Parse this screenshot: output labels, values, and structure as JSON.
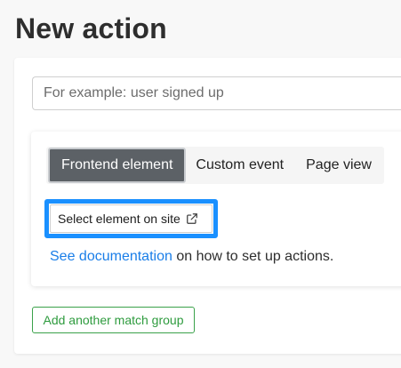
{
  "page": {
    "title": "New action"
  },
  "form": {
    "name_placeholder": "For example: user signed up",
    "name_value": ""
  },
  "match_group": {
    "tabs": [
      {
        "label": "Frontend element",
        "active": true
      },
      {
        "label": "Custom event",
        "active": false
      },
      {
        "label": "Page view",
        "active": false
      }
    ],
    "select_element_label": "Select element on site",
    "select_element_icon": "external-link-icon",
    "doc_link_text": "See documentation",
    "doc_suffix": " on how to set up actions."
  },
  "actions": {
    "add_group_label": "Add another match group"
  },
  "colors": {
    "accent_blue": "#1a90ff",
    "link_blue": "#1a7ee8",
    "active_tab": "#5c6166",
    "success_green": "#2e9b3e"
  }
}
